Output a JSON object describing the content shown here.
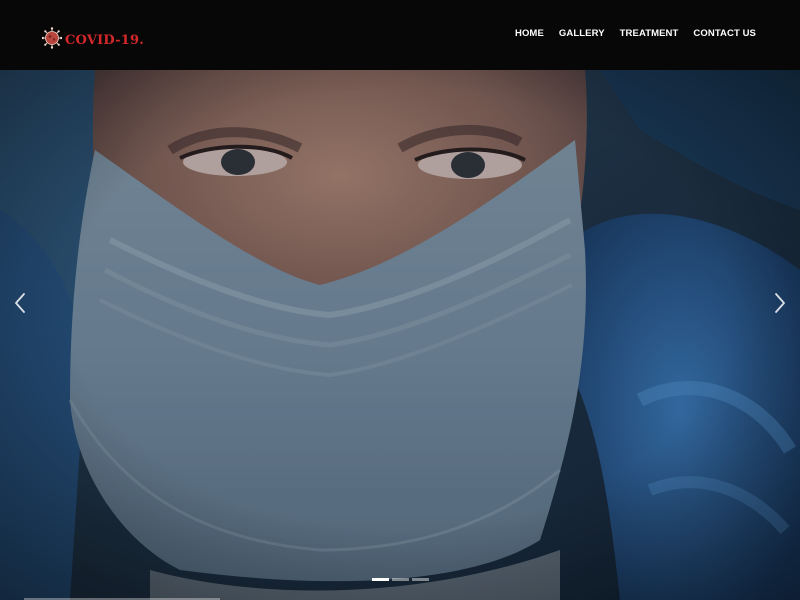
{
  "brand": {
    "text": "COVID-19.",
    "icon": "virus-icon",
    "color": "#d6282a"
  },
  "nav": {
    "items": [
      {
        "label": "HOME"
      },
      {
        "label": "GALLERY"
      },
      {
        "label": "TREATMENT"
      },
      {
        "label": "CONTACT US"
      }
    ]
  },
  "carousel": {
    "slide_image": "masked-medical-worker-photo",
    "prev_icon": "chevron-left-icon",
    "next_icon": "chevron-right-icon",
    "indicator_count": 3,
    "active_indicator": 1
  },
  "colors": {
    "navbar_bg": "#070707",
    "nav_text": "#ffffff",
    "hero_tint": "#1a2a3c"
  }
}
